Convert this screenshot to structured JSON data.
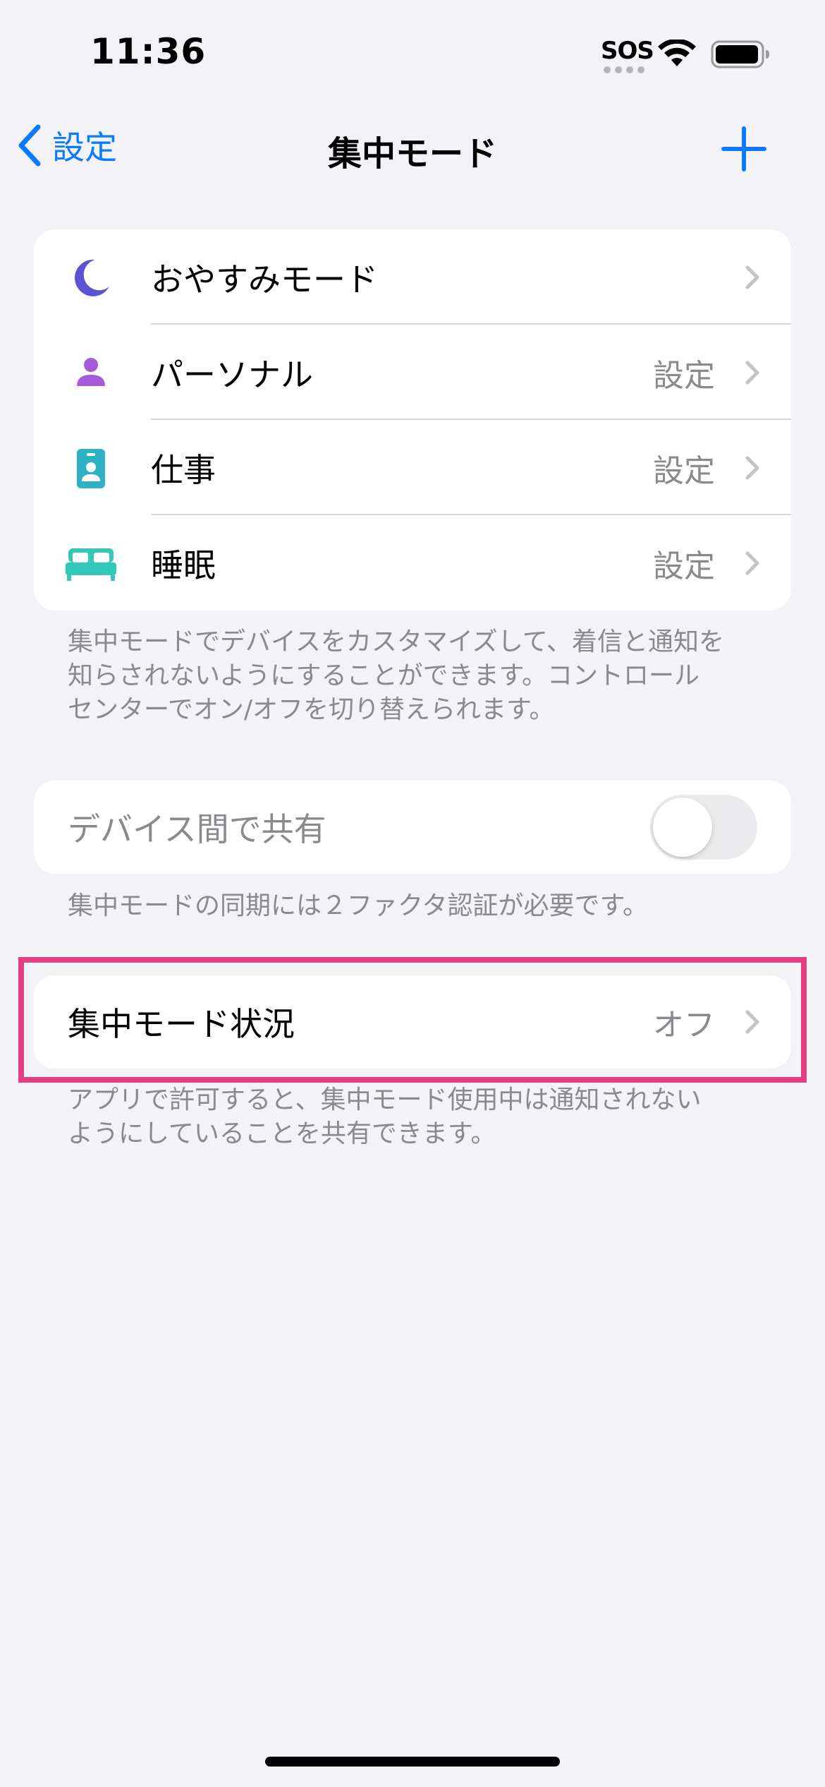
{
  "status": {
    "time": "11:36",
    "sos": "SOS"
  },
  "nav": {
    "back_label": "設定",
    "title": "集中モード"
  },
  "focus_modes": [
    {
      "label": "おやすみモード",
      "value": "",
      "icon": "moon-icon",
      "color": "#5b53d6"
    },
    {
      "label": "パーソナル",
      "value": "設定",
      "icon": "person-icon",
      "color": "#a65bd9"
    },
    {
      "label": "仕事",
      "value": "設定",
      "icon": "id-badge-icon",
      "color": "#2fb1c4"
    },
    {
      "label": "睡眠",
      "value": "設定",
      "icon": "bed-icon",
      "color": "#31c9b8"
    }
  ],
  "focus_note": [
    "集中モードでデバイスをカスタマイズして、着信と通知を",
    "知らされないようにすることができます。コントロール",
    "センターでオン/オフを切り替えられます。"
  ],
  "share": {
    "label": "デバイス間で共有",
    "enabled": false
  },
  "share_note": "集中モードの同期には２ファクタ認証が必要です。",
  "status_row": {
    "label": "集中モード状況",
    "value": "オフ"
  },
  "status_note": [
    "アプリで許可すると、集中モード使用中は通知されない",
    "ようにしていることを共有できます。"
  ],
  "colors": {
    "accent": "#0a7aff",
    "highlight": "#e43f80"
  }
}
